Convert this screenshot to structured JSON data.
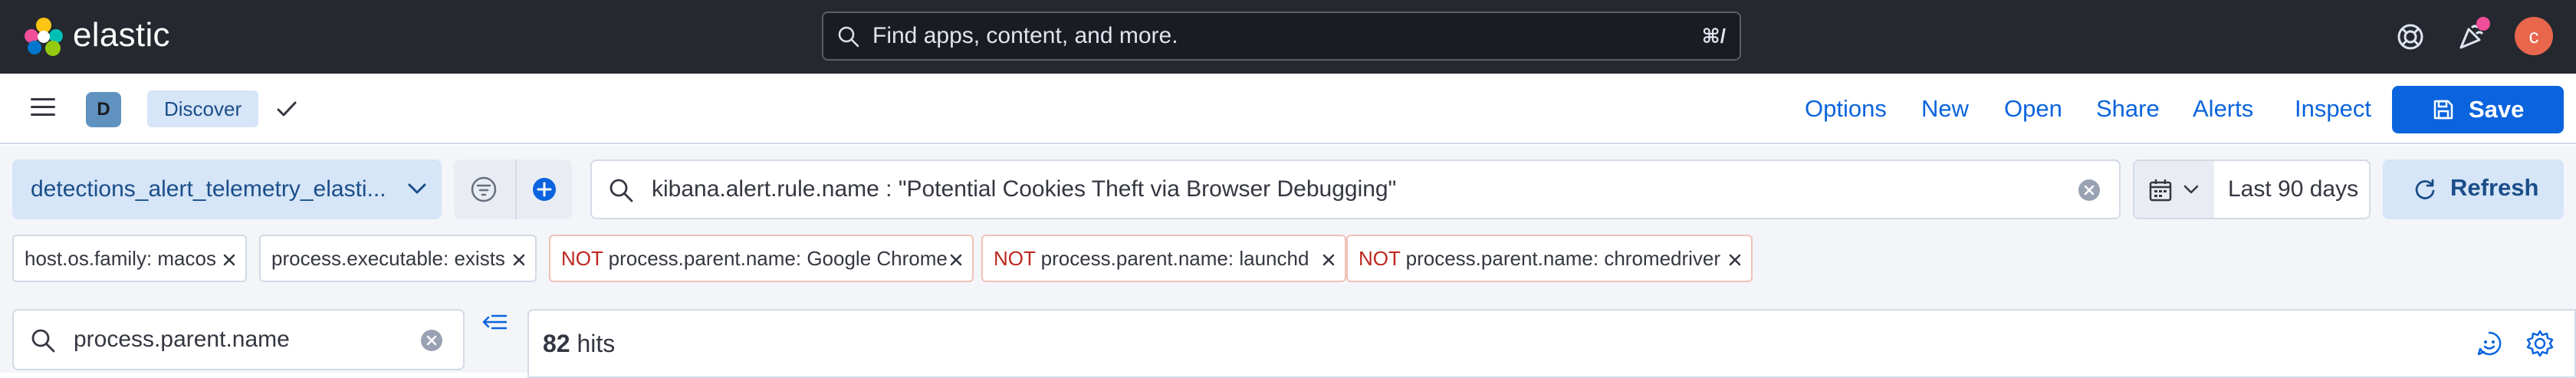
{
  "header": {
    "brand": "elastic",
    "search_placeholder": "Find apps, content, and more.",
    "search_shortcut": "⌘/",
    "avatar_initial": "c",
    "colors": {
      "background": "#25282f",
      "avatar": "#e7664c",
      "news_dot": "#f04e98"
    }
  },
  "nav": {
    "space_initial": "D",
    "breadcrumb": "Discover",
    "links": {
      "options": "Options",
      "new": "New",
      "open": "Open",
      "share": "Share",
      "alerts": "Alerts",
      "inspect": "Inspect"
    },
    "save_label": "Save",
    "colors": {
      "link": "#0b64dd",
      "primary": "#0b64dd"
    }
  },
  "querybar": {
    "data_view": "detections_alert_telemetry_elasti...",
    "query": "kibana.alert.rule.name : \"Potential Cookies Theft via Browser Debugging\"",
    "date_range": "Last 90 days",
    "refresh_label": "Refresh",
    "filters": [
      {
        "negate": "",
        "text": "host.os.family: macos"
      },
      {
        "negate": "",
        "text": "process.executable: exists"
      },
      {
        "negate": "NOT ",
        "text": "process.parent.name: Google Chrome"
      },
      {
        "negate": "NOT ",
        "text": "process.parent.name: launchd"
      },
      {
        "negate": "NOT ",
        "text": "process.parent.name: chromedriver"
      }
    ]
  },
  "sidebar": {
    "field_search_value": "process.parent.name"
  },
  "results": {
    "hits_count": "82",
    "hits_label": " hits"
  },
  "icons": [
    "elastic-logo-icon",
    "search-icon",
    "help-icon",
    "newsfeed-icon",
    "menu-icon",
    "check-icon",
    "save-icon",
    "chevron-down-icon",
    "filter-menu-icon",
    "add-filter-icon",
    "clear-icon",
    "calendar-icon",
    "refresh-icon",
    "close-icon",
    "collapse-icon",
    "ai-assistant-icon",
    "gear-icon"
  ]
}
